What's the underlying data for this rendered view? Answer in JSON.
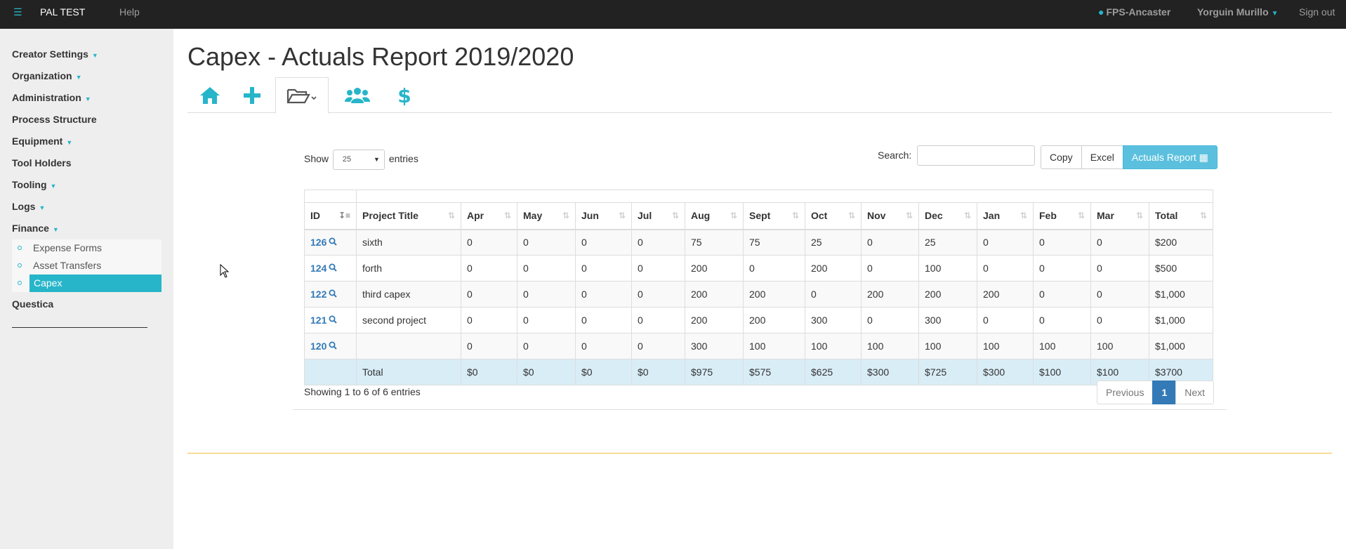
{
  "navbar": {
    "menu_icon": "hamburger-icon",
    "brand": "PAL TEST",
    "help": "Help",
    "location": "FPS-Ancaster",
    "user": "Yorguin Murillo",
    "signout": "Sign out"
  },
  "sidebar": {
    "items": [
      {
        "label": "Creator Settings",
        "dropdown": true
      },
      {
        "label": "Organization",
        "dropdown": true
      },
      {
        "label": "Administration",
        "dropdown": true
      },
      {
        "label": "Process Structure",
        "dropdown": false
      },
      {
        "label": "Equipment",
        "dropdown": true
      },
      {
        "label": "Tool Holders",
        "dropdown": false
      },
      {
        "label": "Tooling",
        "dropdown": true
      },
      {
        "label": "Logs",
        "dropdown": true
      },
      {
        "label": "Finance",
        "dropdown": true
      }
    ],
    "finance_sub": [
      "Expense Forms",
      "Asset Transfers",
      "Capex"
    ],
    "after": "Questica"
  },
  "page": {
    "title": "Capex - Actuals Report 2019/2020",
    "tabs": [
      "home-icon",
      "plus-icon",
      "folder-open-icon",
      "users-icon",
      "dollar-icon"
    ]
  },
  "table": {
    "show_label": "Show",
    "length_value": "25",
    "entries_label": "entries",
    "search_label": "Search:",
    "buttons": {
      "copy": "Copy",
      "excel": "Excel",
      "actuals": "Actuals Report"
    },
    "columns": [
      "ID",
      "Project Title",
      "Apr",
      "May",
      "Jun",
      "Jul",
      "Aug",
      "Sept",
      "Oct",
      "Nov",
      "Dec",
      "Jan",
      "Feb",
      "Mar",
      "Total"
    ],
    "rows": [
      {
        "id": "126",
        "title": "sixth",
        "vals": [
          "0",
          "0",
          "0",
          "0",
          "75",
          "75",
          "25",
          "0",
          "25",
          "0",
          "0",
          "0"
        ],
        "total": "$200"
      },
      {
        "id": "124",
        "title": "forth",
        "vals": [
          "0",
          "0",
          "0",
          "0",
          "200",
          "0",
          "200",
          "0",
          "100",
          "0",
          "0",
          "0"
        ],
        "total": "$500"
      },
      {
        "id": "122",
        "title": "third capex",
        "vals": [
          "0",
          "0",
          "0",
          "0",
          "200",
          "200",
          "0",
          "200",
          "200",
          "200",
          "0",
          "0"
        ],
        "total": "$1,000"
      },
      {
        "id": "121",
        "title": "second project",
        "vals": [
          "0",
          "0",
          "0",
          "0",
          "200",
          "200",
          "300",
          "0",
          "300",
          "0",
          "0",
          "0"
        ],
        "total": "$1,000"
      },
      {
        "id": "120",
        "title": "",
        "vals": [
          "0",
          "0",
          "0",
          "0",
          "300",
          "100",
          "100",
          "100",
          "100",
          "100",
          "100",
          "100"
        ],
        "total": "$1,000"
      }
    ],
    "total_row": {
      "label": "Total",
      "vals": [
        "$0",
        "$0",
        "$0",
        "$0",
        "$975",
        "$575",
        "$625",
        "$300",
        "$725",
        "$300",
        "$100",
        "$100"
      ],
      "total": "$3700"
    },
    "info": "Showing 1 to 6 of 6 entries",
    "pager": {
      "prev": "Previous",
      "current": "1",
      "next": "Next"
    }
  },
  "colors": {
    "accent": "#26b5c9",
    "link": "#337ab7",
    "navbar": "#222222"
  }
}
